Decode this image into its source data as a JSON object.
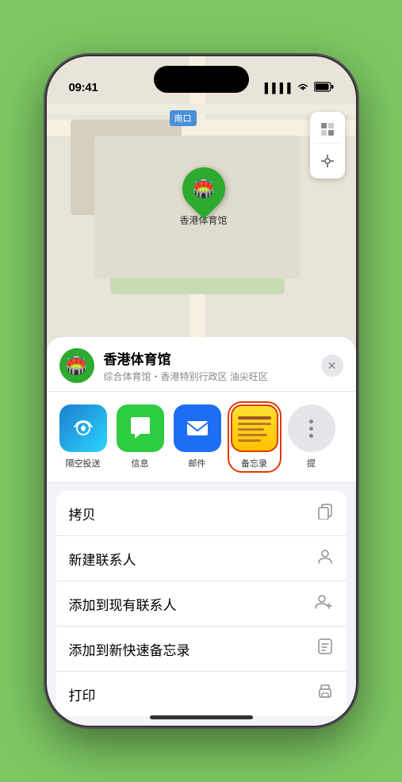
{
  "status_bar": {
    "time": "09:41",
    "signal_icon": "▐▐▐▐",
    "wifi_icon": "wifi",
    "battery_icon": "battery"
  },
  "map": {
    "south_entrance_label": "南口",
    "pin_label": "香港体育馆"
  },
  "venue_card": {
    "name": "香港体育馆",
    "description": "综合体育馆・香港特别行政区 油尖旺区",
    "close_label": "×"
  },
  "share_row": {
    "items": [
      {
        "id": "airdrop",
        "label": "隔空投送",
        "icon": "airdrop"
      },
      {
        "id": "messages",
        "label": "信息",
        "icon": "messages"
      },
      {
        "id": "mail",
        "label": "邮件",
        "icon": "mail"
      },
      {
        "id": "notes",
        "label": "备忘录",
        "icon": "notes"
      },
      {
        "id": "more",
        "label": "提",
        "icon": "more"
      }
    ]
  },
  "action_list": {
    "items": [
      {
        "id": "copy",
        "label": "拷贝",
        "icon": "📋"
      },
      {
        "id": "new_contact",
        "label": "新建联系人",
        "icon": "👤"
      },
      {
        "id": "add_existing",
        "label": "添加到现有联系人",
        "icon": "👤➕"
      },
      {
        "id": "add_notes",
        "label": "添加到新快速备忘录",
        "icon": "📝"
      },
      {
        "id": "print",
        "label": "打印",
        "icon": "🖨️"
      }
    ]
  }
}
